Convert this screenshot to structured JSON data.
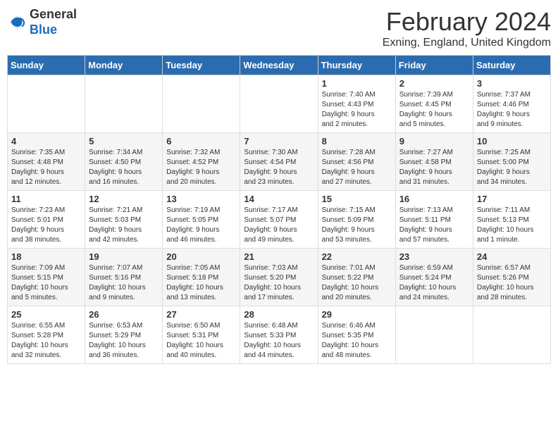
{
  "logo": {
    "general": "General",
    "blue": "Blue"
  },
  "header": {
    "month": "February 2024",
    "location": "Exning, England, United Kingdom"
  },
  "days_of_week": [
    "Sunday",
    "Monday",
    "Tuesday",
    "Wednesday",
    "Thursday",
    "Friday",
    "Saturday"
  ],
  "weeks": [
    [
      {
        "day": "",
        "info": ""
      },
      {
        "day": "",
        "info": ""
      },
      {
        "day": "",
        "info": ""
      },
      {
        "day": "",
        "info": ""
      },
      {
        "day": "1",
        "info": "Sunrise: 7:40 AM\nSunset: 4:43 PM\nDaylight: 9 hours\nand 2 minutes."
      },
      {
        "day": "2",
        "info": "Sunrise: 7:39 AM\nSunset: 4:45 PM\nDaylight: 9 hours\nand 5 minutes."
      },
      {
        "day": "3",
        "info": "Sunrise: 7:37 AM\nSunset: 4:46 PM\nDaylight: 9 hours\nand 9 minutes."
      }
    ],
    [
      {
        "day": "4",
        "info": "Sunrise: 7:35 AM\nSunset: 4:48 PM\nDaylight: 9 hours\nand 12 minutes."
      },
      {
        "day": "5",
        "info": "Sunrise: 7:34 AM\nSunset: 4:50 PM\nDaylight: 9 hours\nand 16 minutes."
      },
      {
        "day": "6",
        "info": "Sunrise: 7:32 AM\nSunset: 4:52 PM\nDaylight: 9 hours\nand 20 minutes."
      },
      {
        "day": "7",
        "info": "Sunrise: 7:30 AM\nSunset: 4:54 PM\nDaylight: 9 hours\nand 23 minutes."
      },
      {
        "day": "8",
        "info": "Sunrise: 7:28 AM\nSunset: 4:56 PM\nDaylight: 9 hours\nand 27 minutes."
      },
      {
        "day": "9",
        "info": "Sunrise: 7:27 AM\nSunset: 4:58 PM\nDaylight: 9 hours\nand 31 minutes."
      },
      {
        "day": "10",
        "info": "Sunrise: 7:25 AM\nSunset: 5:00 PM\nDaylight: 9 hours\nand 34 minutes."
      }
    ],
    [
      {
        "day": "11",
        "info": "Sunrise: 7:23 AM\nSunset: 5:01 PM\nDaylight: 9 hours\nand 38 minutes."
      },
      {
        "day": "12",
        "info": "Sunrise: 7:21 AM\nSunset: 5:03 PM\nDaylight: 9 hours\nand 42 minutes."
      },
      {
        "day": "13",
        "info": "Sunrise: 7:19 AM\nSunset: 5:05 PM\nDaylight: 9 hours\nand 46 minutes."
      },
      {
        "day": "14",
        "info": "Sunrise: 7:17 AM\nSunset: 5:07 PM\nDaylight: 9 hours\nand 49 minutes."
      },
      {
        "day": "15",
        "info": "Sunrise: 7:15 AM\nSunset: 5:09 PM\nDaylight: 9 hours\nand 53 minutes."
      },
      {
        "day": "16",
        "info": "Sunrise: 7:13 AM\nSunset: 5:11 PM\nDaylight: 9 hours\nand 57 minutes."
      },
      {
        "day": "17",
        "info": "Sunrise: 7:11 AM\nSunset: 5:13 PM\nDaylight: 10 hours\nand 1 minute."
      }
    ],
    [
      {
        "day": "18",
        "info": "Sunrise: 7:09 AM\nSunset: 5:15 PM\nDaylight: 10 hours\nand 5 minutes."
      },
      {
        "day": "19",
        "info": "Sunrise: 7:07 AM\nSunset: 5:16 PM\nDaylight: 10 hours\nand 9 minutes."
      },
      {
        "day": "20",
        "info": "Sunrise: 7:05 AM\nSunset: 5:18 PM\nDaylight: 10 hours\nand 13 minutes."
      },
      {
        "day": "21",
        "info": "Sunrise: 7:03 AM\nSunset: 5:20 PM\nDaylight: 10 hours\nand 17 minutes."
      },
      {
        "day": "22",
        "info": "Sunrise: 7:01 AM\nSunset: 5:22 PM\nDaylight: 10 hours\nand 20 minutes."
      },
      {
        "day": "23",
        "info": "Sunrise: 6:59 AM\nSunset: 5:24 PM\nDaylight: 10 hours\nand 24 minutes."
      },
      {
        "day": "24",
        "info": "Sunrise: 6:57 AM\nSunset: 5:26 PM\nDaylight: 10 hours\nand 28 minutes."
      }
    ],
    [
      {
        "day": "25",
        "info": "Sunrise: 6:55 AM\nSunset: 5:28 PM\nDaylight: 10 hours\nand 32 minutes."
      },
      {
        "day": "26",
        "info": "Sunrise: 6:53 AM\nSunset: 5:29 PM\nDaylight: 10 hours\nand 36 minutes."
      },
      {
        "day": "27",
        "info": "Sunrise: 6:50 AM\nSunset: 5:31 PM\nDaylight: 10 hours\nand 40 minutes."
      },
      {
        "day": "28",
        "info": "Sunrise: 6:48 AM\nSunset: 5:33 PM\nDaylight: 10 hours\nand 44 minutes."
      },
      {
        "day": "29",
        "info": "Sunrise: 6:46 AM\nSunset: 5:35 PM\nDaylight: 10 hours\nand 48 minutes."
      },
      {
        "day": "",
        "info": ""
      },
      {
        "day": "",
        "info": ""
      }
    ]
  ],
  "colors": {
    "header_bg": "#2b6cb0",
    "header_text": "#ffffff",
    "accent_blue": "#1a6bbf"
  }
}
